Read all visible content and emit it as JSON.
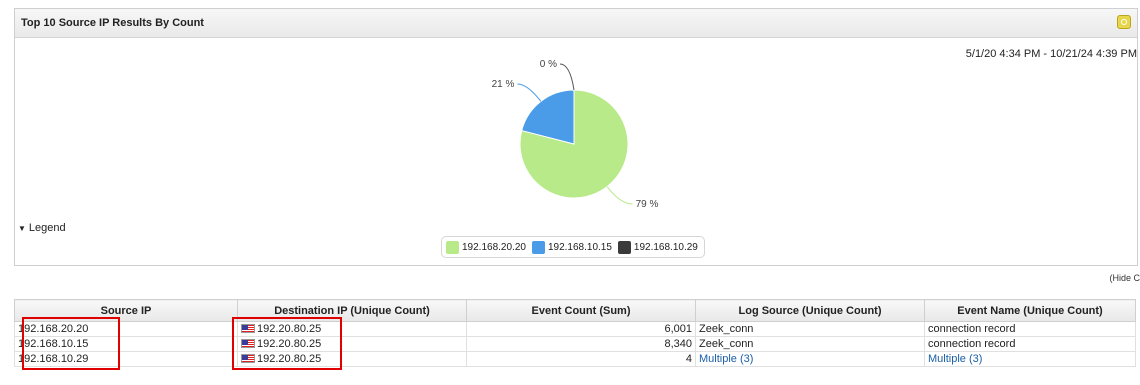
{
  "widget": {
    "title": "Top 10 Source IP Results By Count",
    "date_range": "5/1/20 4:34 PM - 10/21/24 4:39 PM",
    "settings_icon": "gear-icon",
    "legend_toggle": "Legend",
    "hide_link": "(Hide C"
  },
  "chart_data": {
    "type": "pie",
    "slices": [
      {
        "name": "192.168.20.20",
        "value": 79,
        "label": "79 %",
        "color": "#b9ea8a"
      },
      {
        "name": "192.168.10.15",
        "value": 21,
        "label": "21 %",
        "color": "#4a9be8"
      },
      {
        "name": "192.168.10.29",
        "value": 0,
        "label": "0 %",
        "color": "#3a3a3a"
      }
    ],
    "legend": [
      "192.168.20.20",
      "192.168.10.15",
      "192.168.10.29"
    ],
    "legend_placement": "bottom"
  },
  "table": {
    "headers": [
      "Source IP",
      "Destination IP (Unique Count)",
      "Event Count (Sum)",
      "Log Source (Unique Count)",
      "Event Name (Unique Count)"
    ],
    "rows": [
      {
        "source": "192.168.20.20",
        "dest": "192.20.80.25",
        "count": "6,001",
        "log_source": "Zeek_conn",
        "event_name": "connection record"
      },
      {
        "source": "192.168.10.15",
        "dest": "192.20.80.25",
        "count": "8,340",
        "log_source": "Zeek_conn",
        "event_name": "connection record"
      },
      {
        "source": "192.168.10.29",
        "dest": "192.20.80.25",
        "count": "4",
        "log_source": "Multiple (3)",
        "event_name": "Multiple (3)"
      }
    ]
  },
  "colors": {
    "highlight": "#e00000",
    "link": "#1a5fa8"
  }
}
